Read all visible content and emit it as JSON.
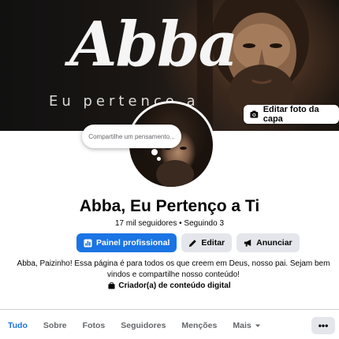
{
  "cover": {
    "title": "Abba",
    "subtitle": "Eu pertenço a",
    "edit_button_label": "Editar foto da capa",
    "edit_button_icon": "camera-icon"
  },
  "profile": {
    "thought_placeholder": "Compartilhe um pensamento...",
    "name": "Abba, Eu Pertenço a Ti",
    "stats": "17 mil seguidores • Seguindo 3",
    "bio": "Abba, Paizinho! Essa página é para todos os que creem em Deus, nosso pai. Sejam bem vindos e compartilhe nosso conteúdo!",
    "category": "Criador(a) de conteúdo digital",
    "category_icon": "briefcase-icon"
  },
  "actions": [
    {
      "label": "Painel profissional",
      "icon": "bar-chart-icon"
    },
    {
      "label": "Editar",
      "icon": "pencil-icon"
    },
    {
      "label": "Anunciar",
      "icon": "megaphone-icon"
    }
  ],
  "tabs": [
    {
      "label": "Tudo",
      "active": true
    },
    {
      "label": "Sobre"
    },
    {
      "label": "Fotos"
    },
    {
      "label": "Seguidores"
    },
    {
      "label": "Menções"
    },
    {
      "label": "Mais"
    }
  ],
  "more_button_label": "•••",
  "colors": {
    "accent": "#1b74e4",
    "secondary_button": "#e4e6eb",
    "muted_text": "#65676b"
  }
}
